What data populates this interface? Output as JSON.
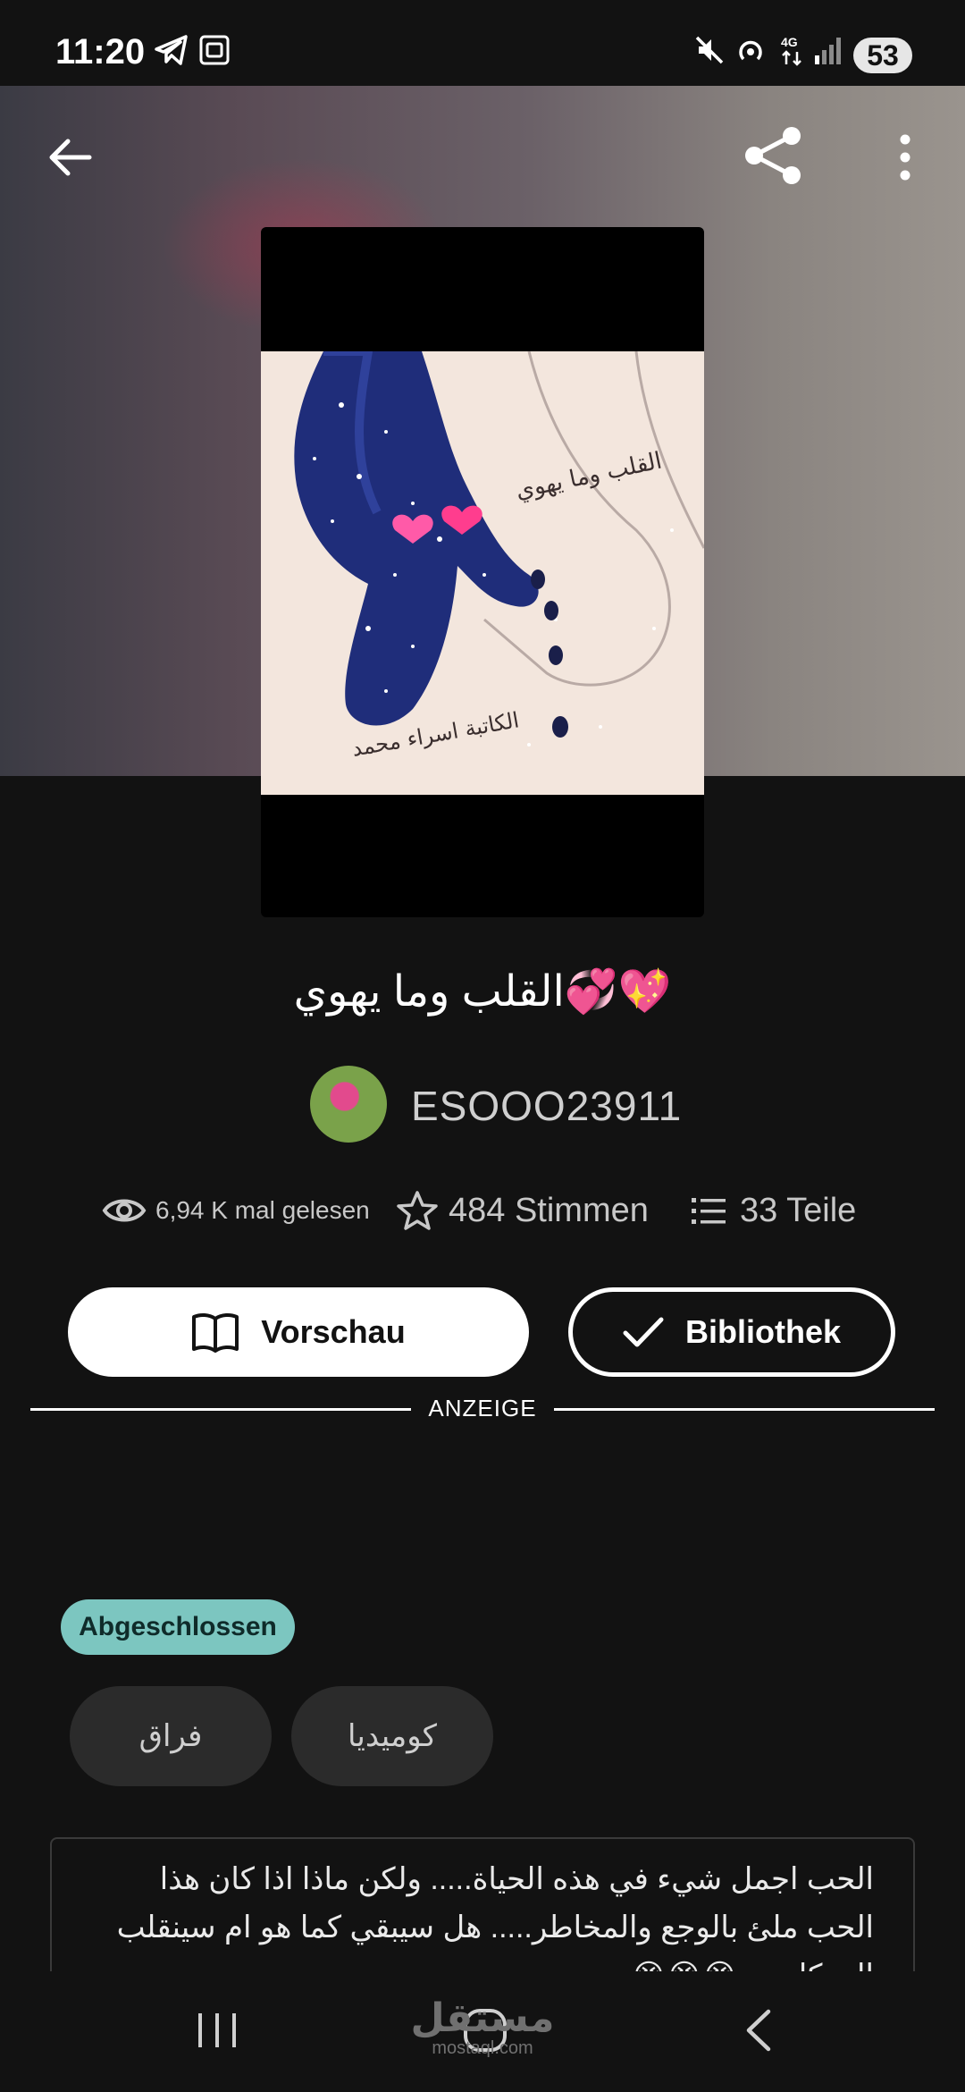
{
  "status_bar": {
    "time": "11:20",
    "battery": "53"
  },
  "story": {
    "title": "القلب وما يهوي💞💖",
    "author": "ESOOO23911",
    "cover_caption_1": "القلب وما يهوي",
    "cover_caption_2": "الكاتبة اسراء محمد",
    "stats": {
      "reads": "6,94 K mal gelesen",
      "votes": "484 Stimmen",
      "parts": "33 Teile"
    },
    "status_badge": "Abgeschlossen",
    "tags": [
      "فراق",
      "كوميديا"
    ],
    "description": "الحب اجمل شيء في هذه الحياة..... ولكن ماذا اذا كان هذا الحب ملئ بالوجع والمخاطر..... هل سيبقي كما هو ام سينقلب الي كابوس😭😭😭"
  },
  "actions": {
    "preview_label": "Vorschau",
    "library_label": "Bibliothek"
  },
  "ad_label": "ANZEIGE",
  "watermark": {
    "main": "مستقل",
    "sub": "mostaql.com"
  },
  "icons": {
    "back": "back-arrow-icon",
    "share": "share-icon",
    "more": "more-vert-icon",
    "eye": "eye-icon",
    "star": "star-icon",
    "list": "list-icon",
    "book": "book-icon",
    "check": "check-icon"
  },
  "colors": {
    "background": "#121212",
    "badge": "#7cc6c0",
    "tag_bg": "#2b2b2b"
  }
}
